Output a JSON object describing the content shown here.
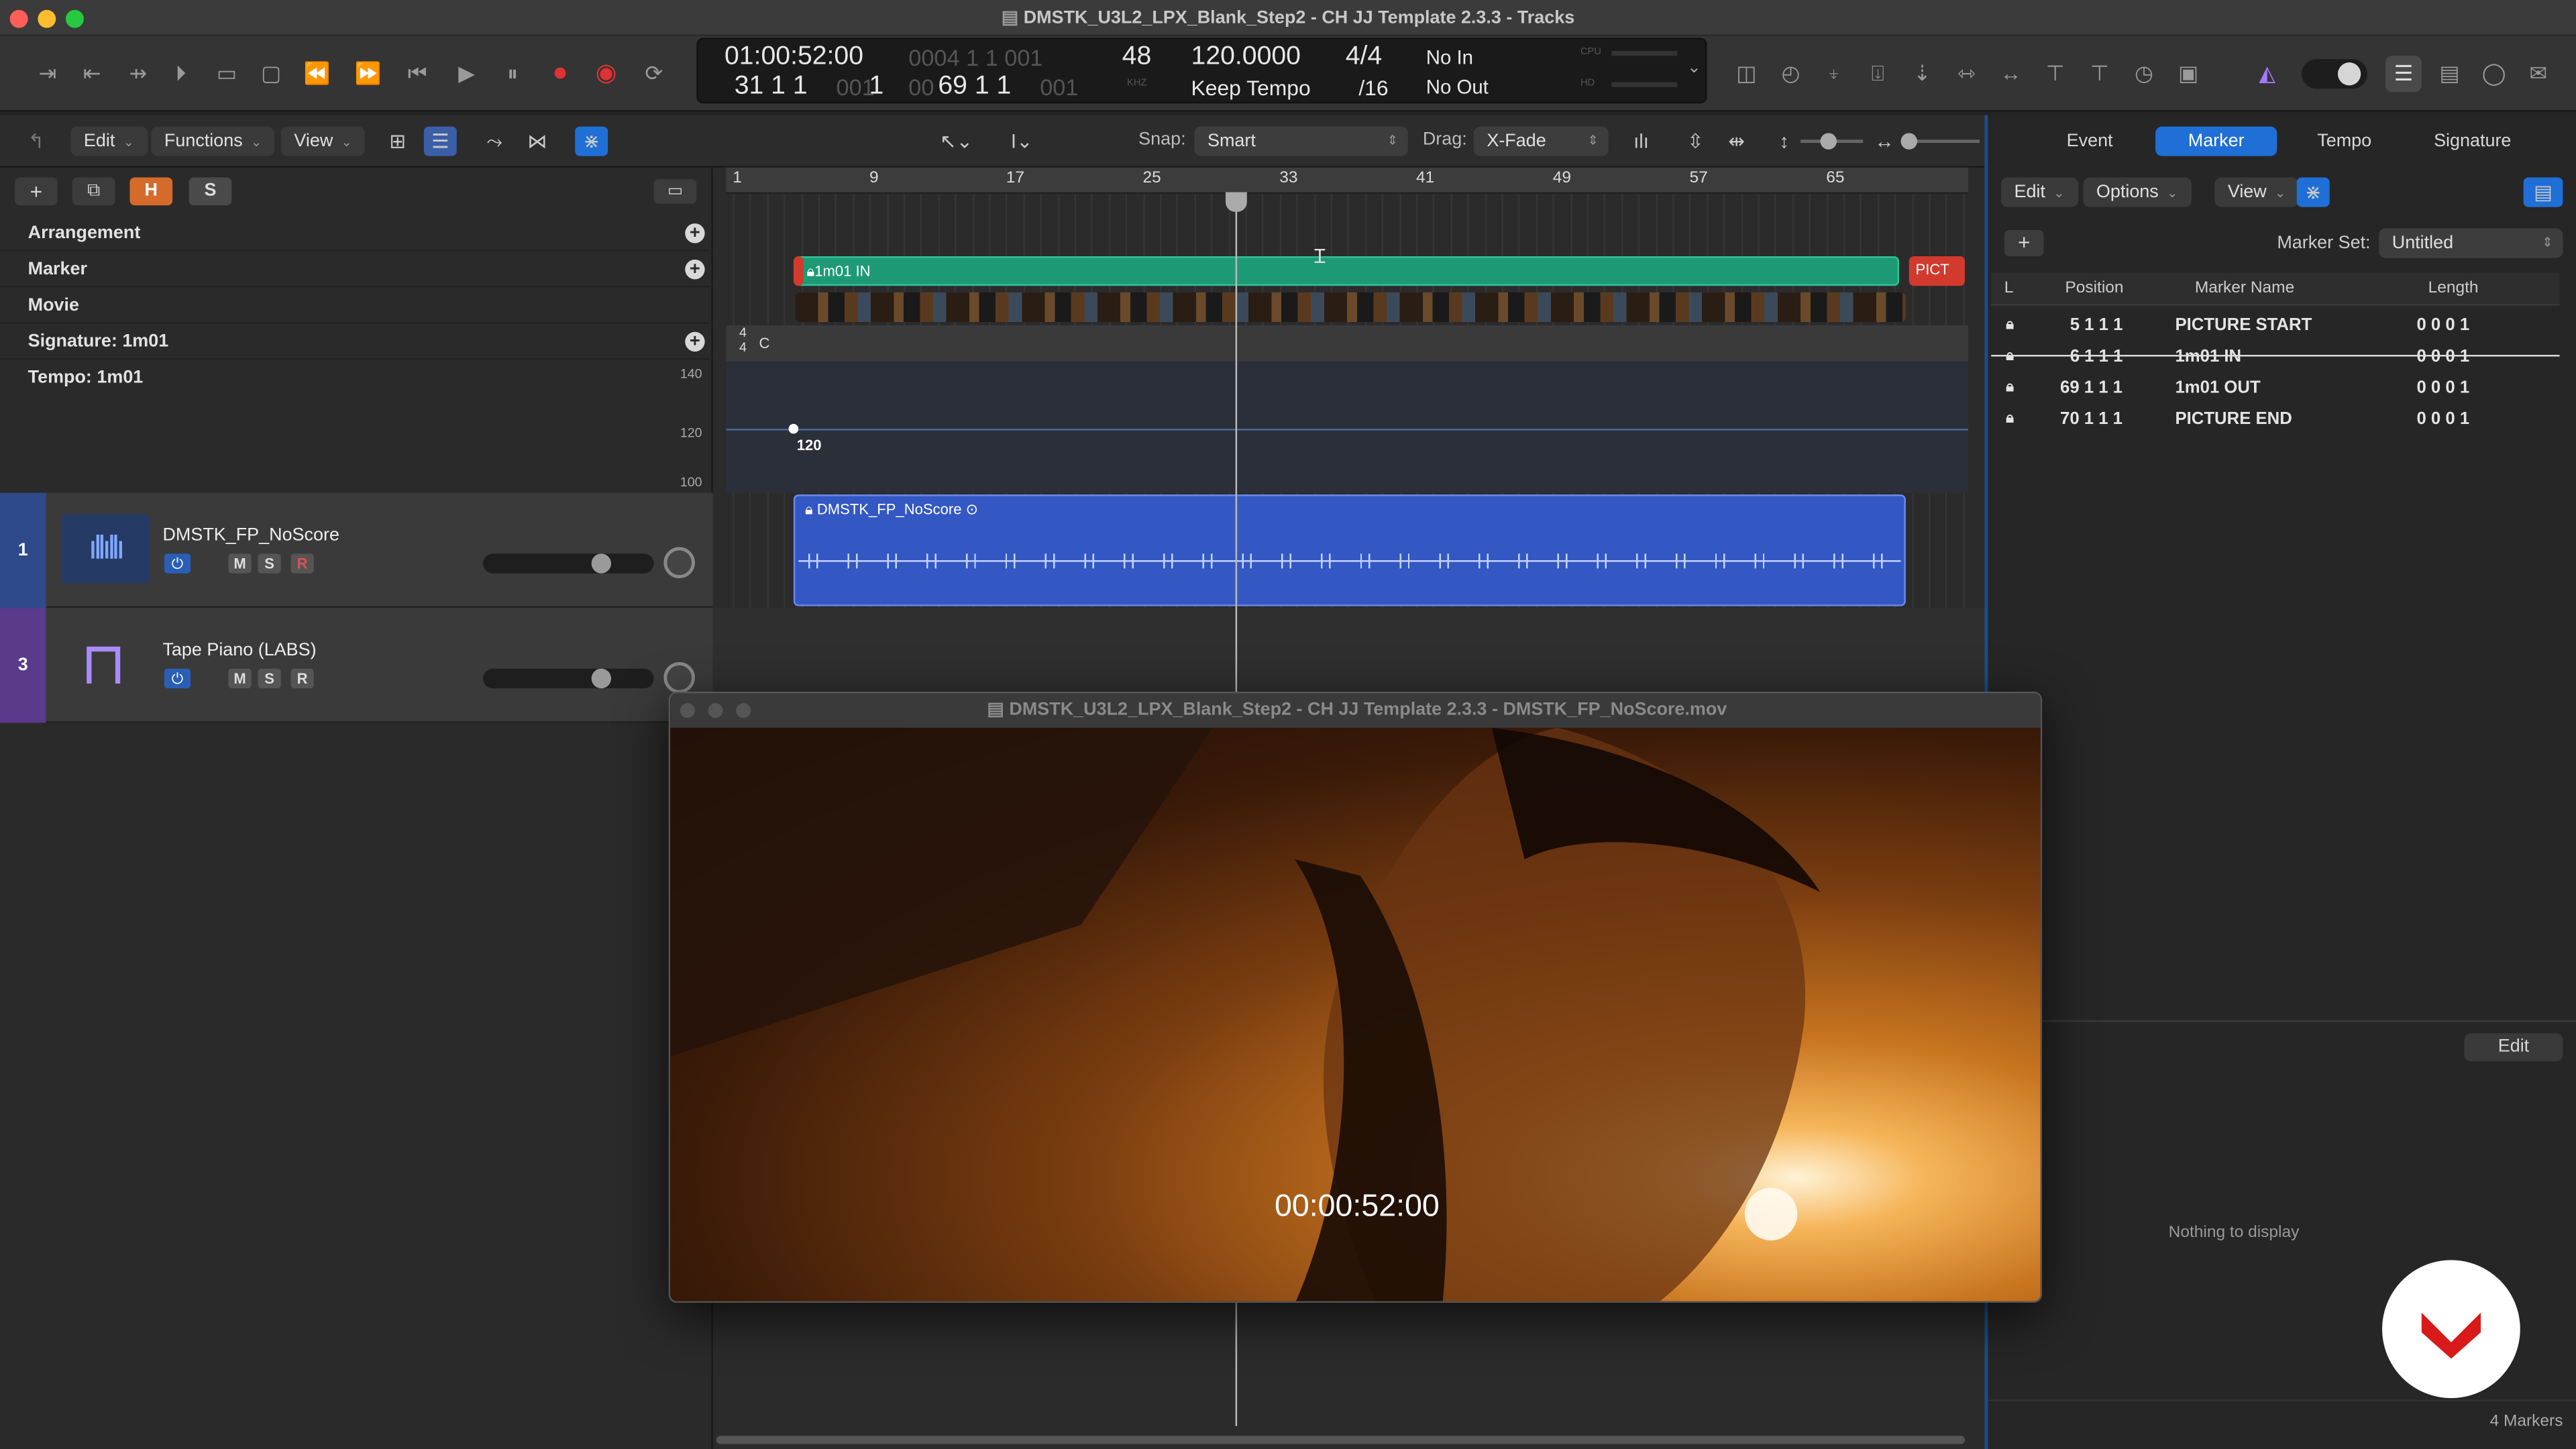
{
  "window": {
    "title": "DMSTK_U3L2_LPX_Blank_Step2 - CH JJ Template 2.3.3 - Tracks"
  },
  "lcd": {
    "smpte": "01:00:52:00",
    "smpte_sub": "0004 1 1 001",
    "bars": "31  1  1",
    "bars_dim1": "001",
    "bars_mid": "1",
    "bars2_dim": "00",
    "bars2": "69  1  1",
    "bars2_dim2": "001",
    "sample_rate": "48",
    "sample_rate_unit": "KHZ",
    "tempo": "120.0000",
    "tempo_mode": "Keep Tempo",
    "time_sig": "4/4",
    "division": "/16",
    "in_point": "No In",
    "out_point": "No Out",
    "cpu_label": "CPU",
    "hd_label": "HD"
  },
  "tracks_toolbar": {
    "edit": "Edit",
    "functions": "Functions",
    "view": "View",
    "snap_label": "Snap:",
    "snap_value": "Smart",
    "drag_label": "Drag:",
    "drag_value": "X-Fade"
  },
  "header_buttons": {
    "h": "H",
    "s": "S"
  },
  "global_tracks": {
    "arrangement": "Arrangement",
    "marker": "Marker",
    "movie": "Movie",
    "signature": "Signature: 1m01",
    "tempo": "Tempo: 1m01"
  },
  "tempo_scale": {
    "t140": "140",
    "t120": "120",
    "t100": "100",
    "point_value": "120"
  },
  "signature_lane": {
    "num": "4",
    "den": "4",
    "key": "C"
  },
  "tracks": [
    {
      "number": "1",
      "name": "DMSTK_FP_NoScore",
      "m": "M",
      "s": "S",
      "r": "R"
    },
    {
      "number": "3",
      "name": "Tape Piano (LABS)",
      "m": "M",
      "s": "S",
      "r": "R"
    }
  ],
  "ruler": [
    "1",
    "9",
    "17",
    "25",
    "33",
    "41",
    "49",
    "57",
    "65"
  ],
  "regions": {
    "marker_region": "1m01 IN",
    "marker_end": "PICT",
    "audio_region": "DMSTK_FP_NoScore"
  },
  "right_pane": {
    "tabs": [
      "Event",
      "Marker",
      "Tempo",
      "Signature"
    ],
    "edit": "Edit",
    "options": "Options",
    "view": "View",
    "marker_set_label": "Marker Set:",
    "marker_set_value": "Untitled",
    "columns": {
      "lock": "L",
      "position": "Position",
      "name": "Marker Name",
      "length": "Length"
    },
    "markers": [
      {
        "position": "5  1  1     1",
        "name": "PICTURE START",
        "length": "0  0  0      1"
      },
      {
        "position": "6  1  1     1",
        "name": "1m01 IN",
        "length": "0  0  0      1"
      },
      {
        "position": "69  1  1     1",
        "name": "1m01 OUT",
        "length": "0  0  0      1"
      },
      {
        "position": "70  1  1     1",
        "name": "PICTURE END",
        "length": "0  0  0      1"
      }
    ],
    "lower_edit": "Edit",
    "nothing": "Nothing to display",
    "count": "4 Markers"
  },
  "movie_window": {
    "title": "DMSTK_U3L2_LPX_Blank_Step2 - CH JJ Template 2.3.3 - DMSTK_FP_NoScore.mov",
    "timecode": "00:00:52:00"
  },
  "colors": {
    "accent": "#1f6fd6",
    "marker_green": "#1d9a75",
    "audio_blue": "#3358c4",
    "record_red": "#e03232"
  }
}
